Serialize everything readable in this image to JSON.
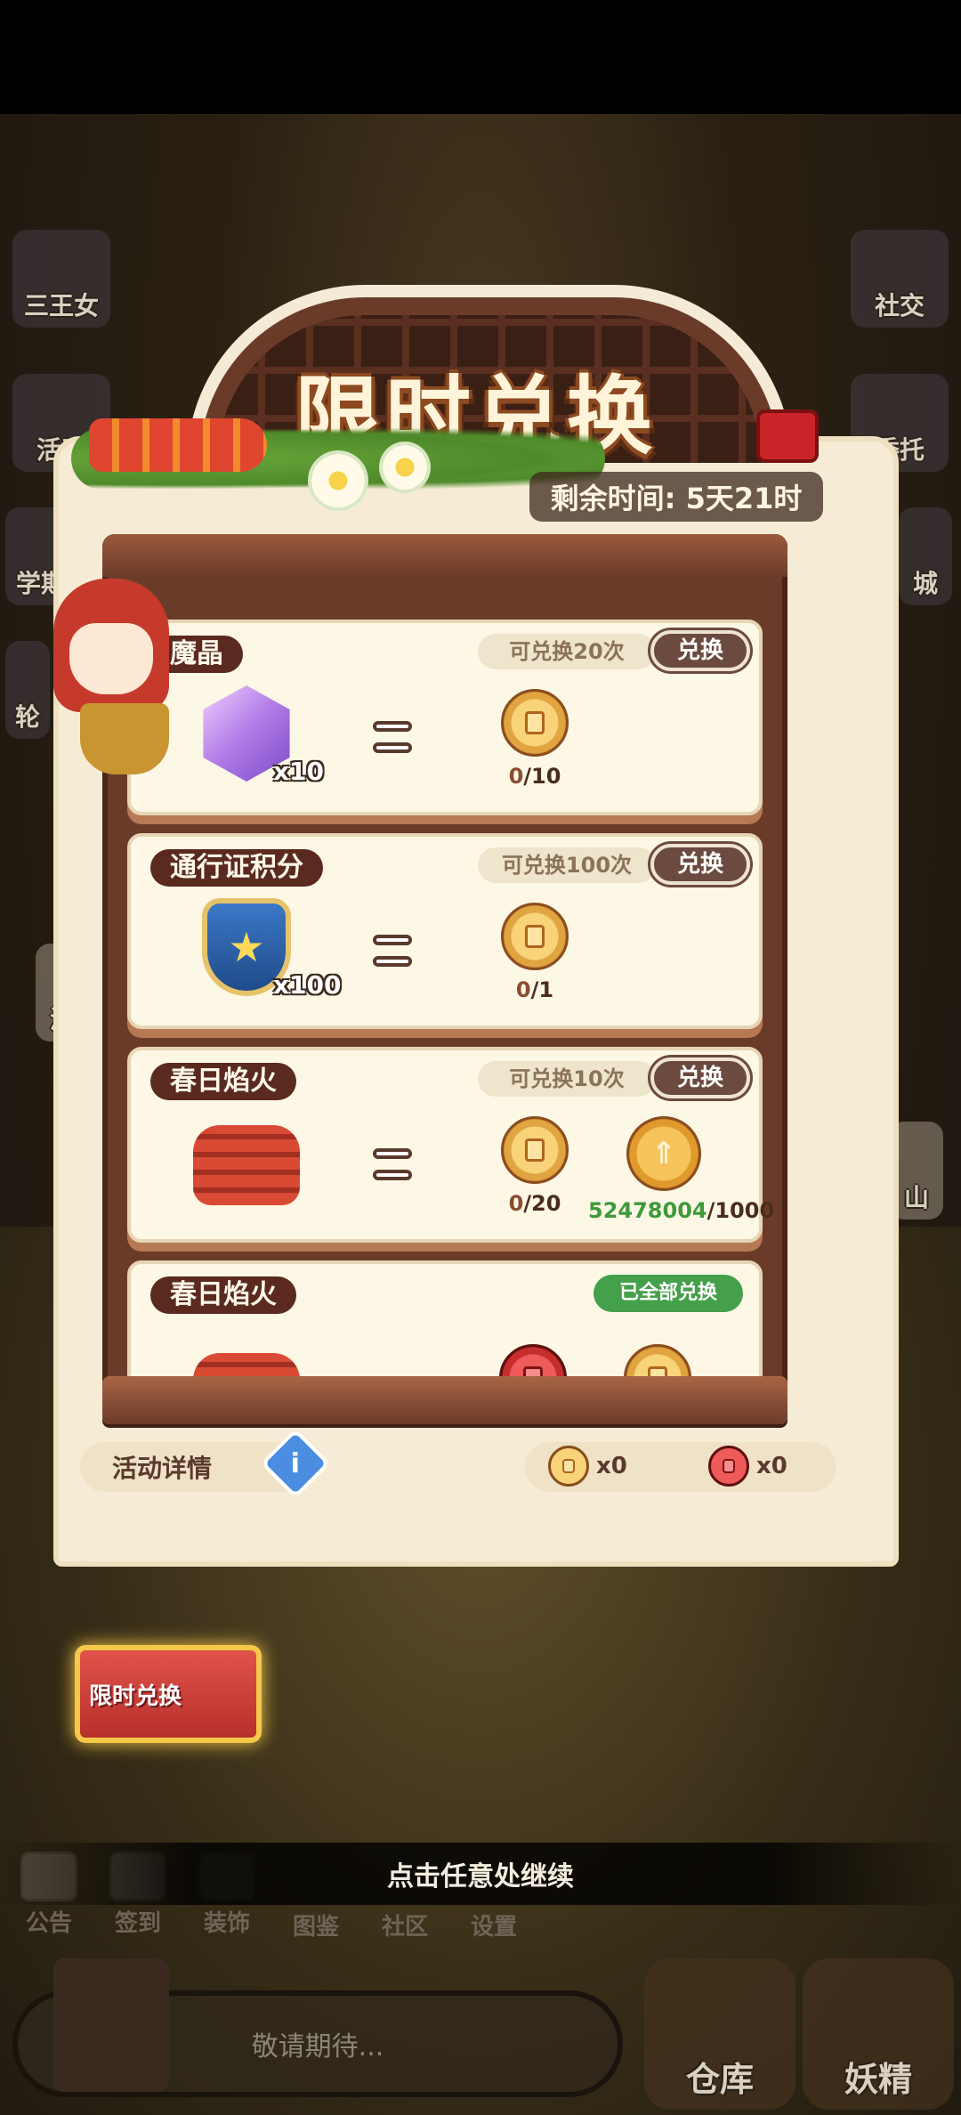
{
  "background": {
    "left_buttons": [
      "三王女",
      "活动",
      "学期",
      "轮",
      "派"
    ],
    "right_buttons": [
      "社交",
      "委托",
      "城",
      "山"
    ]
  },
  "panel": {
    "title": "限时兑换",
    "timer": "剩余时间: 5天21时",
    "items": [
      {
        "name": "魔晶",
        "limit": "可兑换20次",
        "button": "兑换",
        "item_icon": "gem-icon",
        "qty": "x10",
        "costs": [
          {
            "icon": "gold-token-coin",
            "current": "0",
            "required": "/10"
          }
        ]
      },
      {
        "name": "通行证积分",
        "limit": "可兑换100次",
        "button": "兑换",
        "item_icon": "pass-shield-icon",
        "qty": "x100",
        "costs": [
          {
            "icon": "gold-token-coin",
            "current": "0",
            "required": "/1"
          }
        ]
      },
      {
        "name": "春日焰火",
        "limit": "可兑换10次",
        "button": "兑换",
        "item_icon": "firework-basket-icon",
        "qty": "",
        "costs": [
          {
            "icon": "gold-token-coin",
            "current": "0",
            "required": "/20"
          },
          {
            "icon": "gold-arrow-coin",
            "current": "52478004",
            "required": "/1000"
          }
        ]
      },
      {
        "name": "春日焰火",
        "status": "已全部兑换",
        "item_icon": "firework-basket-icon"
      }
    ],
    "details_label": "活动详情",
    "currencies": [
      {
        "icon": "gold-token-coin",
        "amount": "x0"
      },
      {
        "icon": "red-token-coin",
        "amount": "x0"
      }
    ]
  },
  "event_banner": "限时兑换",
  "continue_hint": "点击任意处继续",
  "bottom_nav": [
    "公告",
    "签到",
    "装饰",
    "图鉴",
    "社区",
    "设置"
  ],
  "chat_placeholder": "敬请期待...",
  "big_buttons": [
    "仓库",
    "妖精"
  ],
  "colors": {
    "panel_bg": "#f6ecd6",
    "frame": "#6b3b2a",
    "label_bg": "#5a2a1e",
    "done_green": "#44a04a",
    "highlight_green": "#3f9a3a"
  }
}
